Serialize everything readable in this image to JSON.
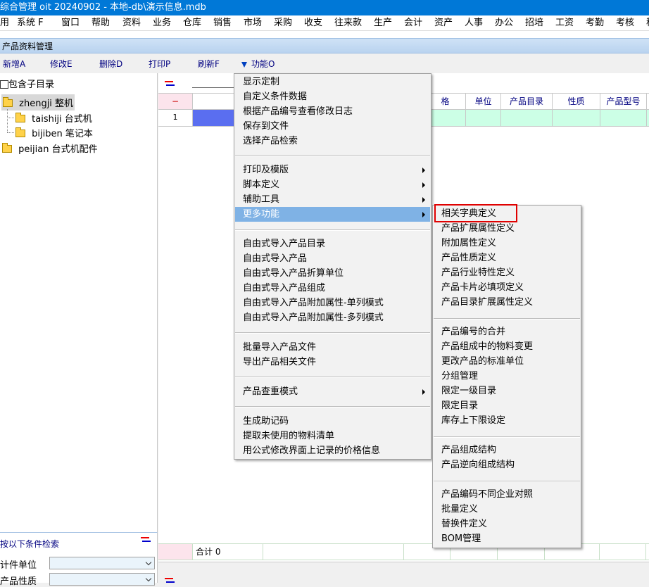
{
  "window": {
    "title": "综合管理 oit 20240902 - 本地-db\\演示信息.mdb"
  },
  "menubar": [
    "用",
    "系统 F",
    "窗口",
    "帮助",
    "资料",
    "业务",
    "仓库",
    "销售",
    "市场",
    "采购",
    "收支",
    "往来款",
    "生产",
    "会计",
    "资产",
    "人事",
    "办公",
    "招培",
    "工资",
    "考勤",
    "考核",
    "称"
  ],
  "tab": {
    "label": "产品资料管理"
  },
  "toolbar": {
    "add": "新增A",
    "edit": "修改E",
    "delete": "删除D",
    "print": "打印P",
    "refresh": "刷新F",
    "function": "功能O"
  },
  "tree": {
    "include_sub": "包含子目录",
    "nodes": [
      {
        "label": "zhengji 整机"
      },
      {
        "label": "taishiji 台式机"
      },
      {
        "label": "bijiben 笔记本"
      },
      {
        "label": "peijian 台式机配件"
      }
    ]
  },
  "search": {
    "title": "按以下条件检索",
    "fields": [
      {
        "label": "计件单位",
        "value": ""
      },
      {
        "label": "产品性质",
        "value": ""
      }
    ]
  },
  "grid": {
    "corner": "−",
    "headers": [
      "格",
      "单位",
      "产品目录",
      "性质",
      "产品型号"
    ],
    "row_number": "1",
    "footer_label": "合计 0"
  },
  "main_menu": {
    "items": [
      {
        "label": "显示定制"
      },
      {
        "label": "自定义条件数据"
      },
      {
        "label": "根据产品编号查看修改日志"
      },
      {
        "label": "保存到文件"
      },
      {
        "label": "选择产品检索"
      },
      {
        "label": "打印及模版",
        "sub": true
      },
      {
        "label": "脚本定义",
        "sub": true
      },
      {
        "label": "辅助工具",
        "sub": true
      },
      {
        "label": "更多功能",
        "sub": true,
        "highlighted": true
      },
      {
        "label": "自由式导入产品目录"
      },
      {
        "label": "自由式导入产品"
      },
      {
        "label": "自由式导入产品折算单位"
      },
      {
        "label": "自由式导入产品组成"
      },
      {
        "label": "自由式导入产品附加属性-单列模式"
      },
      {
        "label": "自由式导入产品附加属性-多列模式"
      },
      {
        "label": "批量导入产品文件"
      },
      {
        "label": "导出产品相关文件"
      },
      {
        "label": "产品查重模式",
        "sub": true
      },
      {
        "label": "生成助记码"
      },
      {
        "label": "提取未使用的物料清单"
      },
      {
        "label": "用公式修改界面上记录的价格信息"
      }
    ]
  },
  "sub_menu": {
    "items": [
      {
        "label": "相关字典定义",
        "boxed": true
      },
      {
        "label": "产品扩展属性定义"
      },
      {
        "label": "附加属性定义"
      },
      {
        "label": "产品性质定义"
      },
      {
        "label": "产品行业特性定义"
      },
      {
        "label": "产品卡片必填项定义"
      },
      {
        "label": "产品目录扩展属性定义"
      },
      {
        "label": "产品编号的合并"
      },
      {
        "label": "产品组成中的物料变更"
      },
      {
        "label": "更改产品的标准单位"
      },
      {
        "label": "分组管理"
      },
      {
        "label": "限定一级目录"
      },
      {
        "label": "限定目录"
      },
      {
        "label": "库存上下限设定"
      },
      {
        "label": "产品组成结构"
      },
      {
        "label": "产品逆向组成结构"
      },
      {
        "label": "产品编码不同企业对照"
      },
      {
        "label": "批量定义"
      },
      {
        "label": "替换件定义"
      },
      {
        "label": "BOM管理"
      }
    ]
  },
  "colors": {
    "titlebar": "#0078d7",
    "highlight": "#7fb2e5",
    "grid_row": "#ccffe6",
    "red_box": "#e00000"
  }
}
